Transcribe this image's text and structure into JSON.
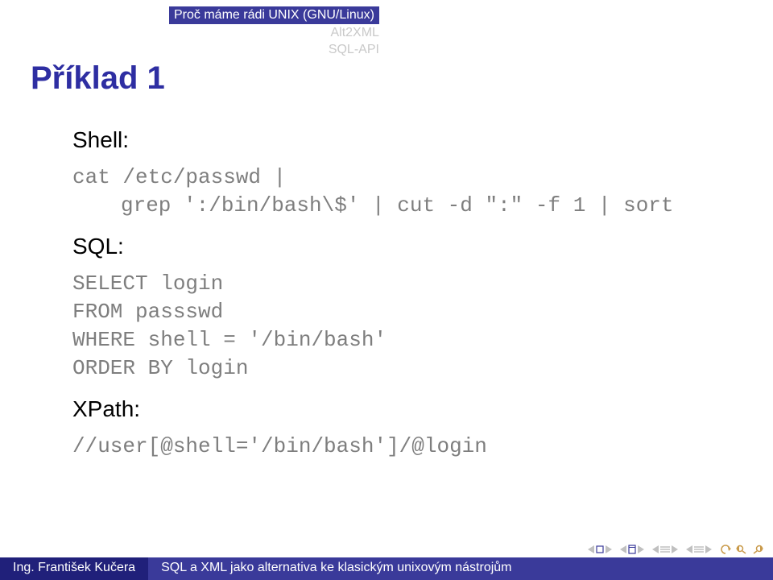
{
  "header": {
    "line1": "Proč máme rádi UNIX (GNU/Linux)",
    "line2": "Alt2XML",
    "line3": "SQL-API"
  },
  "title": "Příklad 1",
  "sections": {
    "shell": {
      "label": "Shell:",
      "code1": "cat /etc/passwd |",
      "code2": "grep ':/bin/bash\\$' | cut -d \":\" -f 1 | sort"
    },
    "sql": {
      "label": "SQL:",
      "code1": "SELECT login",
      "code2": "FROM passswd",
      "code3": "WHERE shell = '/bin/bash'",
      "code4": "ORDER BY login"
    },
    "xpath": {
      "label": "XPath:",
      "code1": "//user[@shell='/bin/bash']/@login"
    }
  },
  "footer": {
    "author": "Ing. František Kučera",
    "doctitle": "SQL a XML jako alternativa ke klasickým unixovým nástrojům"
  }
}
